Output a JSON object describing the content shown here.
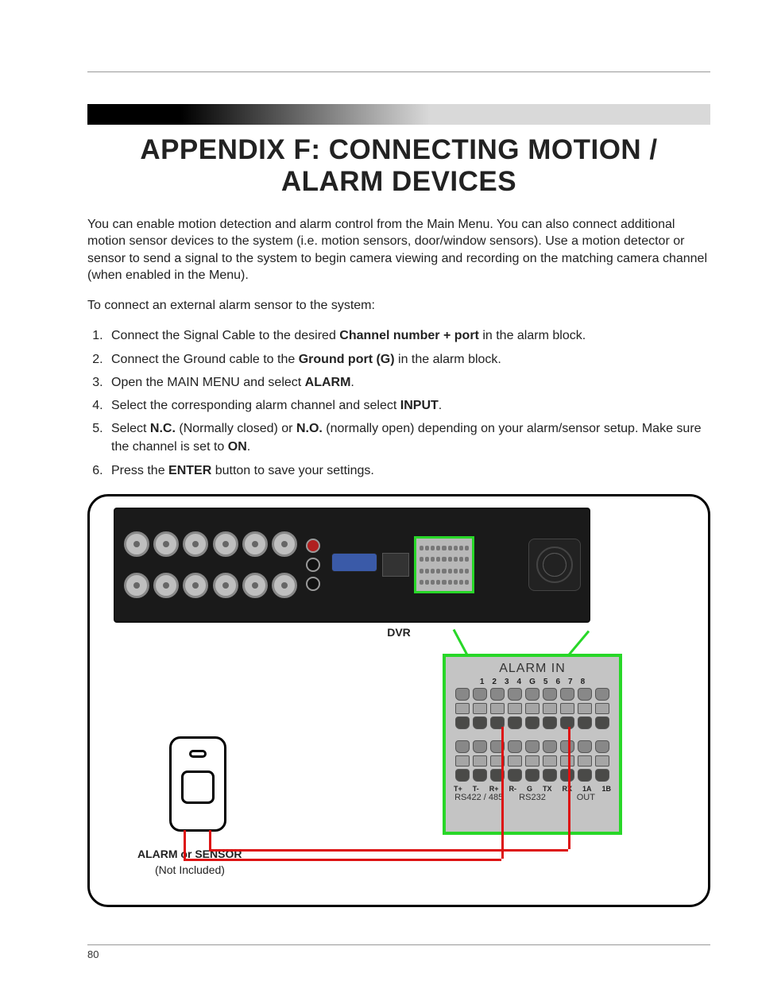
{
  "title": "APPENDIX F: CONNECTING MOTION / ALARM DEVICES",
  "intro": "You can enable motion detection and alarm control from the Main Menu. You can also connect additional motion sensor devices to the system (i.e. motion sensors, door/window sensors). Use a motion detector or sensor to send a signal to the system to begin camera viewing and recording on the matching camera channel (when enabled in the Menu).",
  "lead": "To connect an external alarm sensor to the system:",
  "steps": {
    "s1a": "Connect the Signal Cable to the desired ",
    "s1b": "Channel number + port",
    "s1c": " in the alarm block.",
    "s2a": "Connect the Ground cable to the ",
    "s2b": "Ground port (G)",
    "s2c": " in the alarm block.",
    "s3a": "Open the MAIN MENU and select ",
    "s3b": "ALARM",
    "s3c": ".",
    "s4a": "Select the corresponding alarm channel and select ",
    "s4b": "INPUT",
    "s4c": ".",
    "s5a": "Select ",
    "s5b": "N.C.",
    "s5c": " (Normally closed) or ",
    "s5d": "N.O.",
    "s5e": " (normally open) depending on your alarm/sensor setup. Make sure the channel is set to ",
    "s5f": "ON",
    "s5g": ".",
    "s6a": "Press the ",
    "s6b": "ENTER",
    "s6c": " button to save your settings."
  },
  "figure": {
    "dvr_label": "DVR",
    "alarm_title": "ALARM IN",
    "nums": [
      "1",
      "2",
      "3",
      "4",
      "G",
      "5",
      "6",
      "7",
      "8"
    ],
    "bottom_pins": [
      "T+",
      "T-",
      "R+",
      "R-",
      "G",
      "TX",
      "RX",
      "1A",
      "1B"
    ],
    "sections": {
      "a": "RS422 / 485",
      "b": "RS232",
      "c": "OUT"
    },
    "sensor_label": "ALARM or SENSOR",
    "sensor_sub": "(Not Included)"
  },
  "page": "80"
}
